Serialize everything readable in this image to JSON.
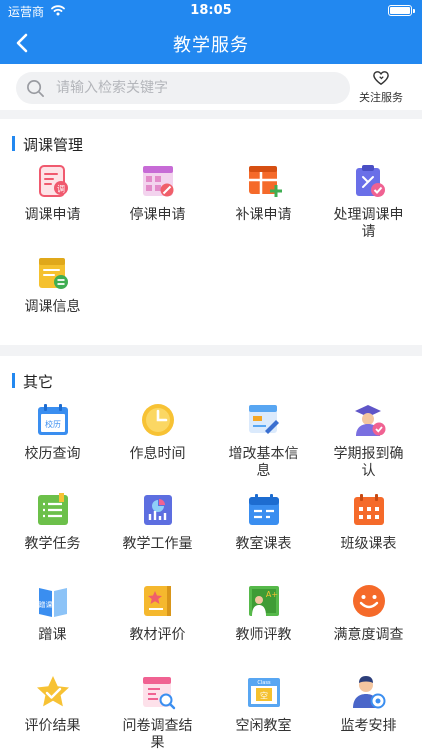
{
  "status_bar": {
    "carrier": "运营商",
    "time": "18:05"
  },
  "nav": {
    "title": "教学服务"
  },
  "search": {
    "placeholder": "请输入检索关键字",
    "value": "",
    "follow_label": "关注服务"
  },
  "sections": [
    {
      "title": "调课管理",
      "items": [
        {
          "label": "调课申请",
          "icon": "adjust-class-icon",
          "color": "#f0596e"
        },
        {
          "label": "停课申请",
          "icon": "stop-class-icon",
          "color": "#c76bd6"
        },
        {
          "label": "补课申请",
          "icon": "makeup-class-icon",
          "color": "#f56a2a"
        },
        {
          "label": "处理调课申请",
          "icon": "handle-adjust-icon",
          "color": "#6a6fe8"
        },
        {
          "label": "调课信息",
          "icon": "adjust-info-icon",
          "color": "#f5c12e"
        }
      ]
    },
    {
      "title": "其它",
      "items": [
        {
          "label": "校历查询",
          "icon": "school-calendar-icon",
          "color": "#3a8ef0",
          "badge": "校历"
        },
        {
          "label": "作息时间",
          "icon": "clock-icon",
          "color": "#f7c234"
        },
        {
          "label": "增改基本信息",
          "icon": "edit-info-icon",
          "color": "#58a6f2"
        },
        {
          "label": "学期报到确认",
          "icon": "graduate-icon",
          "color": "#7a6fe0"
        },
        {
          "label": "教学任务",
          "icon": "task-list-icon",
          "color": "#6cc04a"
        },
        {
          "label": "教学工作量",
          "icon": "workload-chart-icon",
          "color": "#5d6ee0"
        },
        {
          "label": "教室课表",
          "icon": "classroom-schedule-icon",
          "color": "#3a8ef0"
        },
        {
          "label": "班级课表",
          "icon": "class-schedule-icon",
          "color": "#f56a2a"
        },
        {
          "label": "蹭课",
          "icon": "audit-class-icon",
          "color": "#3a8ef0",
          "badge": "蹭课"
        },
        {
          "label": "教材评价",
          "icon": "textbook-rating-icon",
          "color": "#f5b82e"
        },
        {
          "label": "教师评教",
          "icon": "teacher-eval-icon",
          "color": "#56b94a",
          "badge": "A+"
        },
        {
          "label": "满意度调查",
          "icon": "smile-icon",
          "color": "#f56a2a"
        },
        {
          "label": "评价结果",
          "icon": "star-icon",
          "color": "#f7c234"
        },
        {
          "label": "问卷调查结果",
          "icon": "survey-result-icon",
          "color": "#f06292"
        },
        {
          "label": "空闲教室",
          "icon": "free-classroom-icon",
          "color": "#58a6f2",
          "badge": "空",
          "sign": "Class"
        },
        {
          "label": "监考安排",
          "icon": "proctor-icon",
          "color": "#4a66c9"
        }
      ]
    }
  ]
}
